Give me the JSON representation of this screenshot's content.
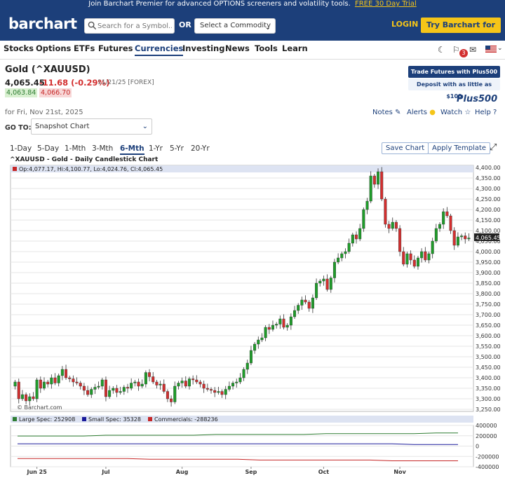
{
  "promo": {
    "text": "Join Barchart Premier for advanced OPTIONS screeners and volatility tools.",
    "link": "FREE 30 Day Trial"
  },
  "header": {
    "logo": "barchart",
    "search_placeholder": "Search for a Symbol...",
    "or_label": "OR",
    "commodity_select": "Select a Commodity",
    "login": "LOGIN",
    "try_button": "Try Barchart for Free"
  },
  "nav": {
    "items": [
      "Stocks",
      "Options",
      "ETFs",
      "Futures",
      "Currencies",
      "Investing",
      "News",
      "Tools",
      "Learn"
    ],
    "active": "Currencies",
    "notification_count": "3",
    "icons": [
      "moon-icon",
      "flag-icon",
      "mail-icon",
      "us-flag-icon"
    ]
  },
  "quote": {
    "title": "Gold (^XAUUSD)",
    "price": "4,065.45",
    "change": "-11.68 (-0.29%)",
    "meta": "11/21/25 [FOREX]",
    "bid": "4,063.84",
    "ask": "4,066.70",
    "for_date": "for Fri, Nov 21st, 2025"
  },
  "ad": {
    "trade_text": "Trade Futures with Plus500 >>",
    "deposit_text": "Deposit with as little as $100",
    "logo": "Plus500"
  },
  "tools": {
    "notes": "Notes",
    "alerts": "Alerts",
    "watch": "Watch",
    "help": "Help"
  },
  "goto": {
    "label": "GO TO:",
    "value": "Snapshot Chart"
  },
  "ranges": [
    "1-Day",
    "5-Day",
    "1-Mth",
    "3-Mth",
    "6-Mth",
    "1-Yr",
    "5-Yr",
    "20-Yr"
  ],
  "active_range": "6-Mth",
  "buttons": {
    "save_chart": "Save Chart",
    "apply_template": "Apply Template"
  },
  "chart_data": {
    "type": "candlestick",
    "title": "^XAUUSD - Gold - Daily Candlestick Chart",
    "ohlc_label": "Op:4,077.17, Hi:4,100.77, Lo:4,024.76, Cl:4,065.45",
    "last_price_label": "4,065.45",
    "watermark": "© Barchart.com",
    "y_ticks": [
      3250,
      3300,
      3350,
      3400,
      3450,
      3500,
      3550,
      3600,
      3650,
      3700,
      3750,
      3800,
      3850,
      3900,
      3950,
      4000,
      4050,
      4100,
      4150,
      4200,
      4250,
      4300,
      4350,
      4400
    ],
    "y_tick_labels": [
      "3,250.00",
      "3,300.00",
      "3,350.00",
      "3,400.00",
      "3,450.00",
      "3,500.00",
      "3,550.00",
      "3,600.00",
      "3,650.00",
      "3,700.00",
      "3,750.00",
      "3,800.00",
      "3,850.00",
      "3,900.00",
      "3,950.00",
      "4,000.00",
      "4,050.00",
      "4,100.00",
      "4,150.00",
      "4,200.00",
      "4,250.00",
      "4,300.00",
      "4,350.00",
      "4,400.00"
    ],
    "ylim": [
      3240,
      4410
    ],
    "x_labels": [
      {
        "label": "Jun 25",
        "index": 6
      },
      {
        "label": "Jul",
        "index": 25
      },
      {
        "label": "Aug",
        "index": 46
      },
      {
        "label": "Sep",
        "index": 65
      },
      {
        "label": "Oct",
        "index": 85
      },
      {
        "label": "Nov",
        "index": 106
      }
    ],
    "closes": [
      3380,
      3300,
      3320,
      3290,
      3310,
      3300,
      3390,
      3350,
      3380,
      3370,
      3400,
      3375,
      3410,
      3440,
      3400,
      3395,
      3380,
      3375,
      3360,
      3340,
      3320,
      3345,
      3355,
      3360,
      3390,
      3310,
      3340,
      3350,
      3330,
      3335,
      3355,
      3350,
      3375,
      3380,
      3360,
      3370,
      3425,
      3405,
      3380,
      3365,
      3370,
      3335,
      3300,
      3285,
      3360,
      3375,
      3385,
      3360,
      3395,
      3390,
      3380,
      3370,
      3350,
      3345,
      3340,
      3330,
      3335,
      3320,
      3345,
      3360,
      3375,
      3380,
      3400,
      3440,
      3470,
      3530,
      3560,
      3580,
      3590,
      3640,
      3630,
      3650,
      3655,
      3680,
      3640,
      3650,
      3690,
      3720,
      3745,
      3770,
      3760,
      3730,
      3780,
      3850,
      3860,
      3870,
      3820,
      3875,
      3950,
      3970,
      3990,
      4000,
      4040,
      4080,
      4060,
      4110,
      4200,
      4240,
      4360,
      4320,
      4380,
      4250,
      4130,
      4110,
      4140,
      4110,
      4000,
      3940,
      3990,
      3960,
      3930,
      3970,
      4000,
      3960,
      3990,
      4050,
      4110,
      4130,
      4190,
      4170,
      4100,
      4030,
      4070,
      4075,
      4060,
      4065
    ],
    "cot": {
      "series": [
        {
          "name": "Large Spec",
          "value": 252908,
          "color": "#2e7d32"
        },
        {
          "name": "Small Spec",
          "value": 35328,
          "color": "#1a1a9a"
        },
        {
          "name": "Commercials",
          "value": -288236,
          "color": "#c62828"
        }
      ],
      "legend": [
        "Large Spec: 252908",
        "Small Spec: 35328",
        "Commercials: -288236"
      ],
      "y_ticks": [
        400000,
        200000,
        0,
        -200000,
        -400000
      ],
      "y_tick_labels": [
        "400000",
        "200000",
        "0",
        "-200000",
        "-400000"
      ]
    }
  }
}
